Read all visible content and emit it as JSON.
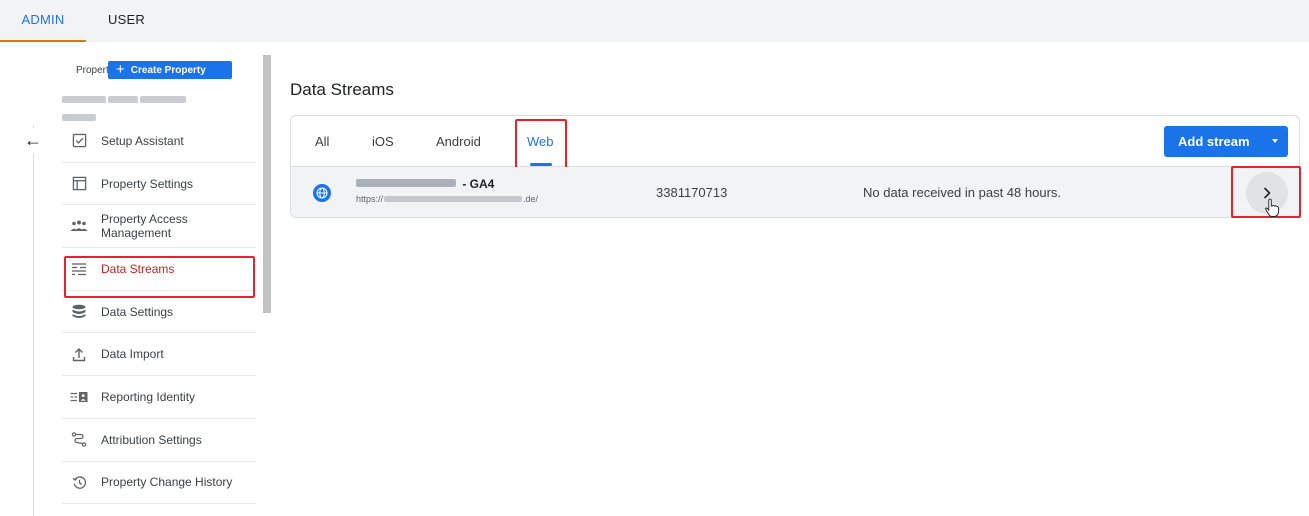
{
  "top_tabs": {
    "admin": "ADMIN",
    "user": "USER"
  },
  "property": {
    "label": "Property",
    "create_button": "Create Property",
    "create_icon": "plus-icon"
  },
  "sidebar": {
    "back_icon": "arrow-left-icon",
    "items": [
      {
        "label": "Setup Assistant",
        "icon": "checkbox-icon"
      },
      {
        "label": "Property Settings",
        "icon": "window-icon"
      },
      {
        "label": "Property Access Management",
        "icon": "people-icon"
      },
      {
        "label": "Data Streams",
        "icon": "streams-icon",
        "active": true
      },
      {
        "label": "Data Settings",
        "icon": "database-icon"
      },
      {
        "label": "Data Import",
        "icon": "upload-icon"
      },
      {
        "label": "Reporting Identity",
        "icon": "identity-icon"
      },
      {
        "label": "Attribution Settings",
        "icon": "route-icon"
      },
      {
        "label": "Property Change History",
        "icon": "history-icon"
      }
    ]
  },
  "main": {
    "title": "Data Streams",
    "tabs": [
      "All",
      "iOS",
      "Android",
      "Web"
    ],
    "active_tab": "Web",
    "add_stream_button": "Add stream",
    "stream": {
      "name_suffix": " - GA4",
      "url_prefix": "https://",
      "url_suffix": ".de/",
      "id": "3381170713",
      "status": "No data received in past 48 hours.",
      "icon": "globe-icon",
      "open_icon": "chevron-right-icon"
    }
  },
  "colors": {
    "accent": "#1a73e8",
    "highlight": "#e8222b",
    "active_nav": "#c5221f",
    "admin_underline": "#e37400"
  }
}
